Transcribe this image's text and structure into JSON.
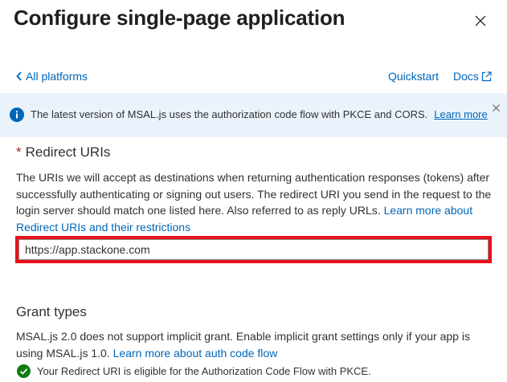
{
  "panel": {
    "title": "Configure single-page application"
  },
  "nav": {
    "back_label": "All platforms",
    "quickstart_label": "Quickstart",
    "docs_label": "Docs"
  },
  "info_bar": {
    "message": "The latest version of MSAL.js uses the authorization code flow with PKCE and CORS.",
    "link_label": "Learn more"
  },
  "redirect_uris": {
    "required_mark": "*",
    "heading": "Redirect URIs",
    "description": "The URIs we will accept as destinations when returning authentication responses (tokens) after successfully authenticating or signing out users. The redirect URI you send in the request to the login server should match one listed here. Also referred to as reply URLs.",
    "link_label": "Learn more about Redirect URIs and their restrictions",
    "uri_value": "https://app.stackone.com"
  },
  "grant_types": {
    "heading": "Grant types",
    "description": "MSAL.js 2.0 does not support implicit grant. Enable implicit grant settings only if your app is using MSAL.js 1.0.",
    "link_label": "Learn more about auth code flow",
    "eligibility_message": "Your Redirect URI is eligible for the Authorization Code Flow with PKCE."
  },
  "colors": {
    "link": "#0066b8",
    "info_background": "#eaf3fc",
    "highlight_border": "#e8101b",
    "required": "#a4262c",
    "success": "#107c10"
  }
}
